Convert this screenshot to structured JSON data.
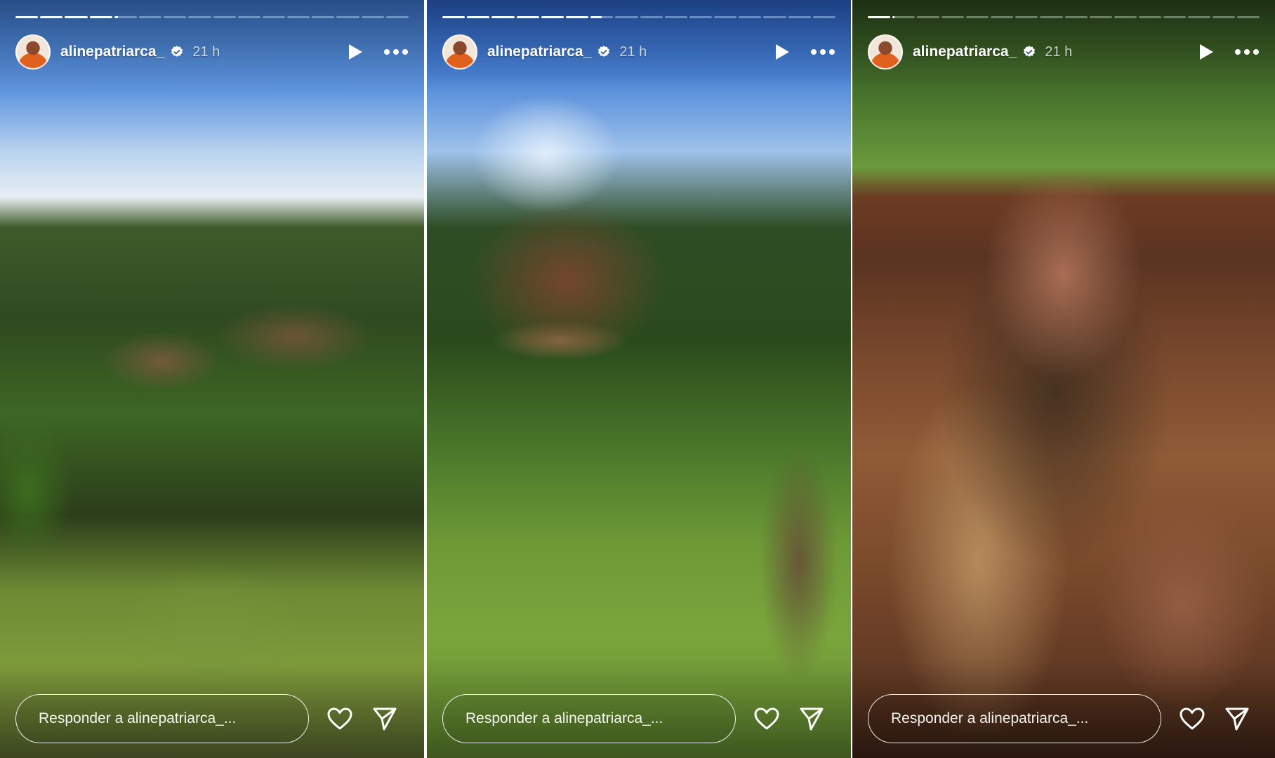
{
  "colors": {
    "text": "#ffffff",
    "verified_badge": "#ffffff",
    "progress_track": "rgba(255,255,255,0.35)",
    "progress_fill": "#ffffff"
  },
  "stories": [
    {
      "user": {
        "username": "alinepatriarca_",
        "verified": true,
        "time": "21 h"
      },
      "progress": {
        "total": 16,
        "completed": 4,
        "current_fraction": 0.15
      },
      "reply_placeholder": "Responder a alinepatriarca_...",
      "icons": [
        "verified-icon",
        "play-icon",
        "more-icon",
        "heart-icon",
        "send-icon"
      ]
    },
    {
      "user": {
        "username": "alinepatriarca_",
        "verified": true,
        "time": "21 h"
      },
      "progress": {
        "total": 16,
        "completed": 6,
        "current_fraction": 0.5
      },
      "reply_placeholder": "Responder a alinepatriarca_...",
      "icons": [
        "verified-icon",
        "play-icon",
        "more-icon",
        "heart-icon",
        "send-icon"
      ]
    },
    {
      "user": {
        "username": "alinepatriarca_",
        "verified": true,
        "time": "21 h"
      },
      "progress": {
        "total": 16,
        "completed": 1,
        "current_fraction": 0.1
      },
      "reply_placeholder": "Responder a alinepatriarca_...",
      "icons": [
        "verified-icon",
        "play-icon",
        "more-icon",
        "heart-icon",
        "send-icon"
      ]
    }
  ]
}
